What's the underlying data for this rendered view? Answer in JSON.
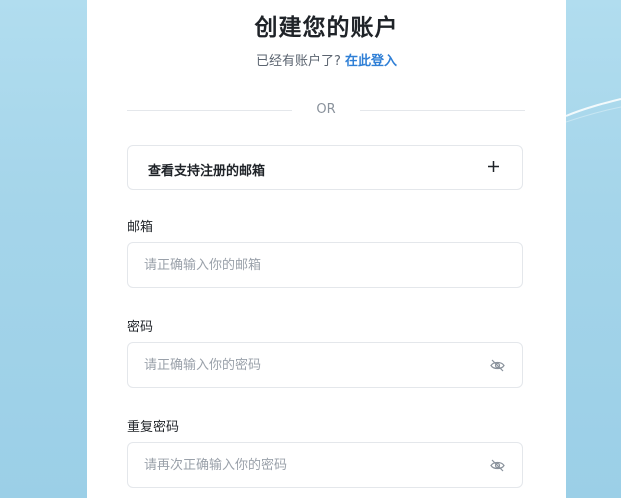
{
  "header": {
    "title": "创建您的账户",
    "prompt": "已经有账户了?",
    "login_link": "在此登入"
  },
  "divider": {
    "text": "OR"
  },
  "supported_emails": {
    "label": "查看支持注册的邮箱",
    "icon": "plus-icon"
  },
  "form": {
    "email": {
      "label": "邮箱",
      "value": "",
      "placeholder": "请正确输入你的邮箱"
    },
    "password": {
      "label": "密码",
      "value": "",
      "placeholder": "请正确输入你的密码",
      "icon": "eye-slash-icon"
    },
    "confirm_password": {
      "label": "重复密码",
      "value": "",
      "placeholder": "请再次正确输入你的密码",
      "icon": "eye-slash-icon"
    }
  },
  "colors": {
    "background": "#a6d6eb",
    "card": "#ffffff",
    "link": "#2f7fd6",
    "border": "#e4e7eb",
    "text": "#1f2328",
    "muted": "#9aa1aa"
  }
}
